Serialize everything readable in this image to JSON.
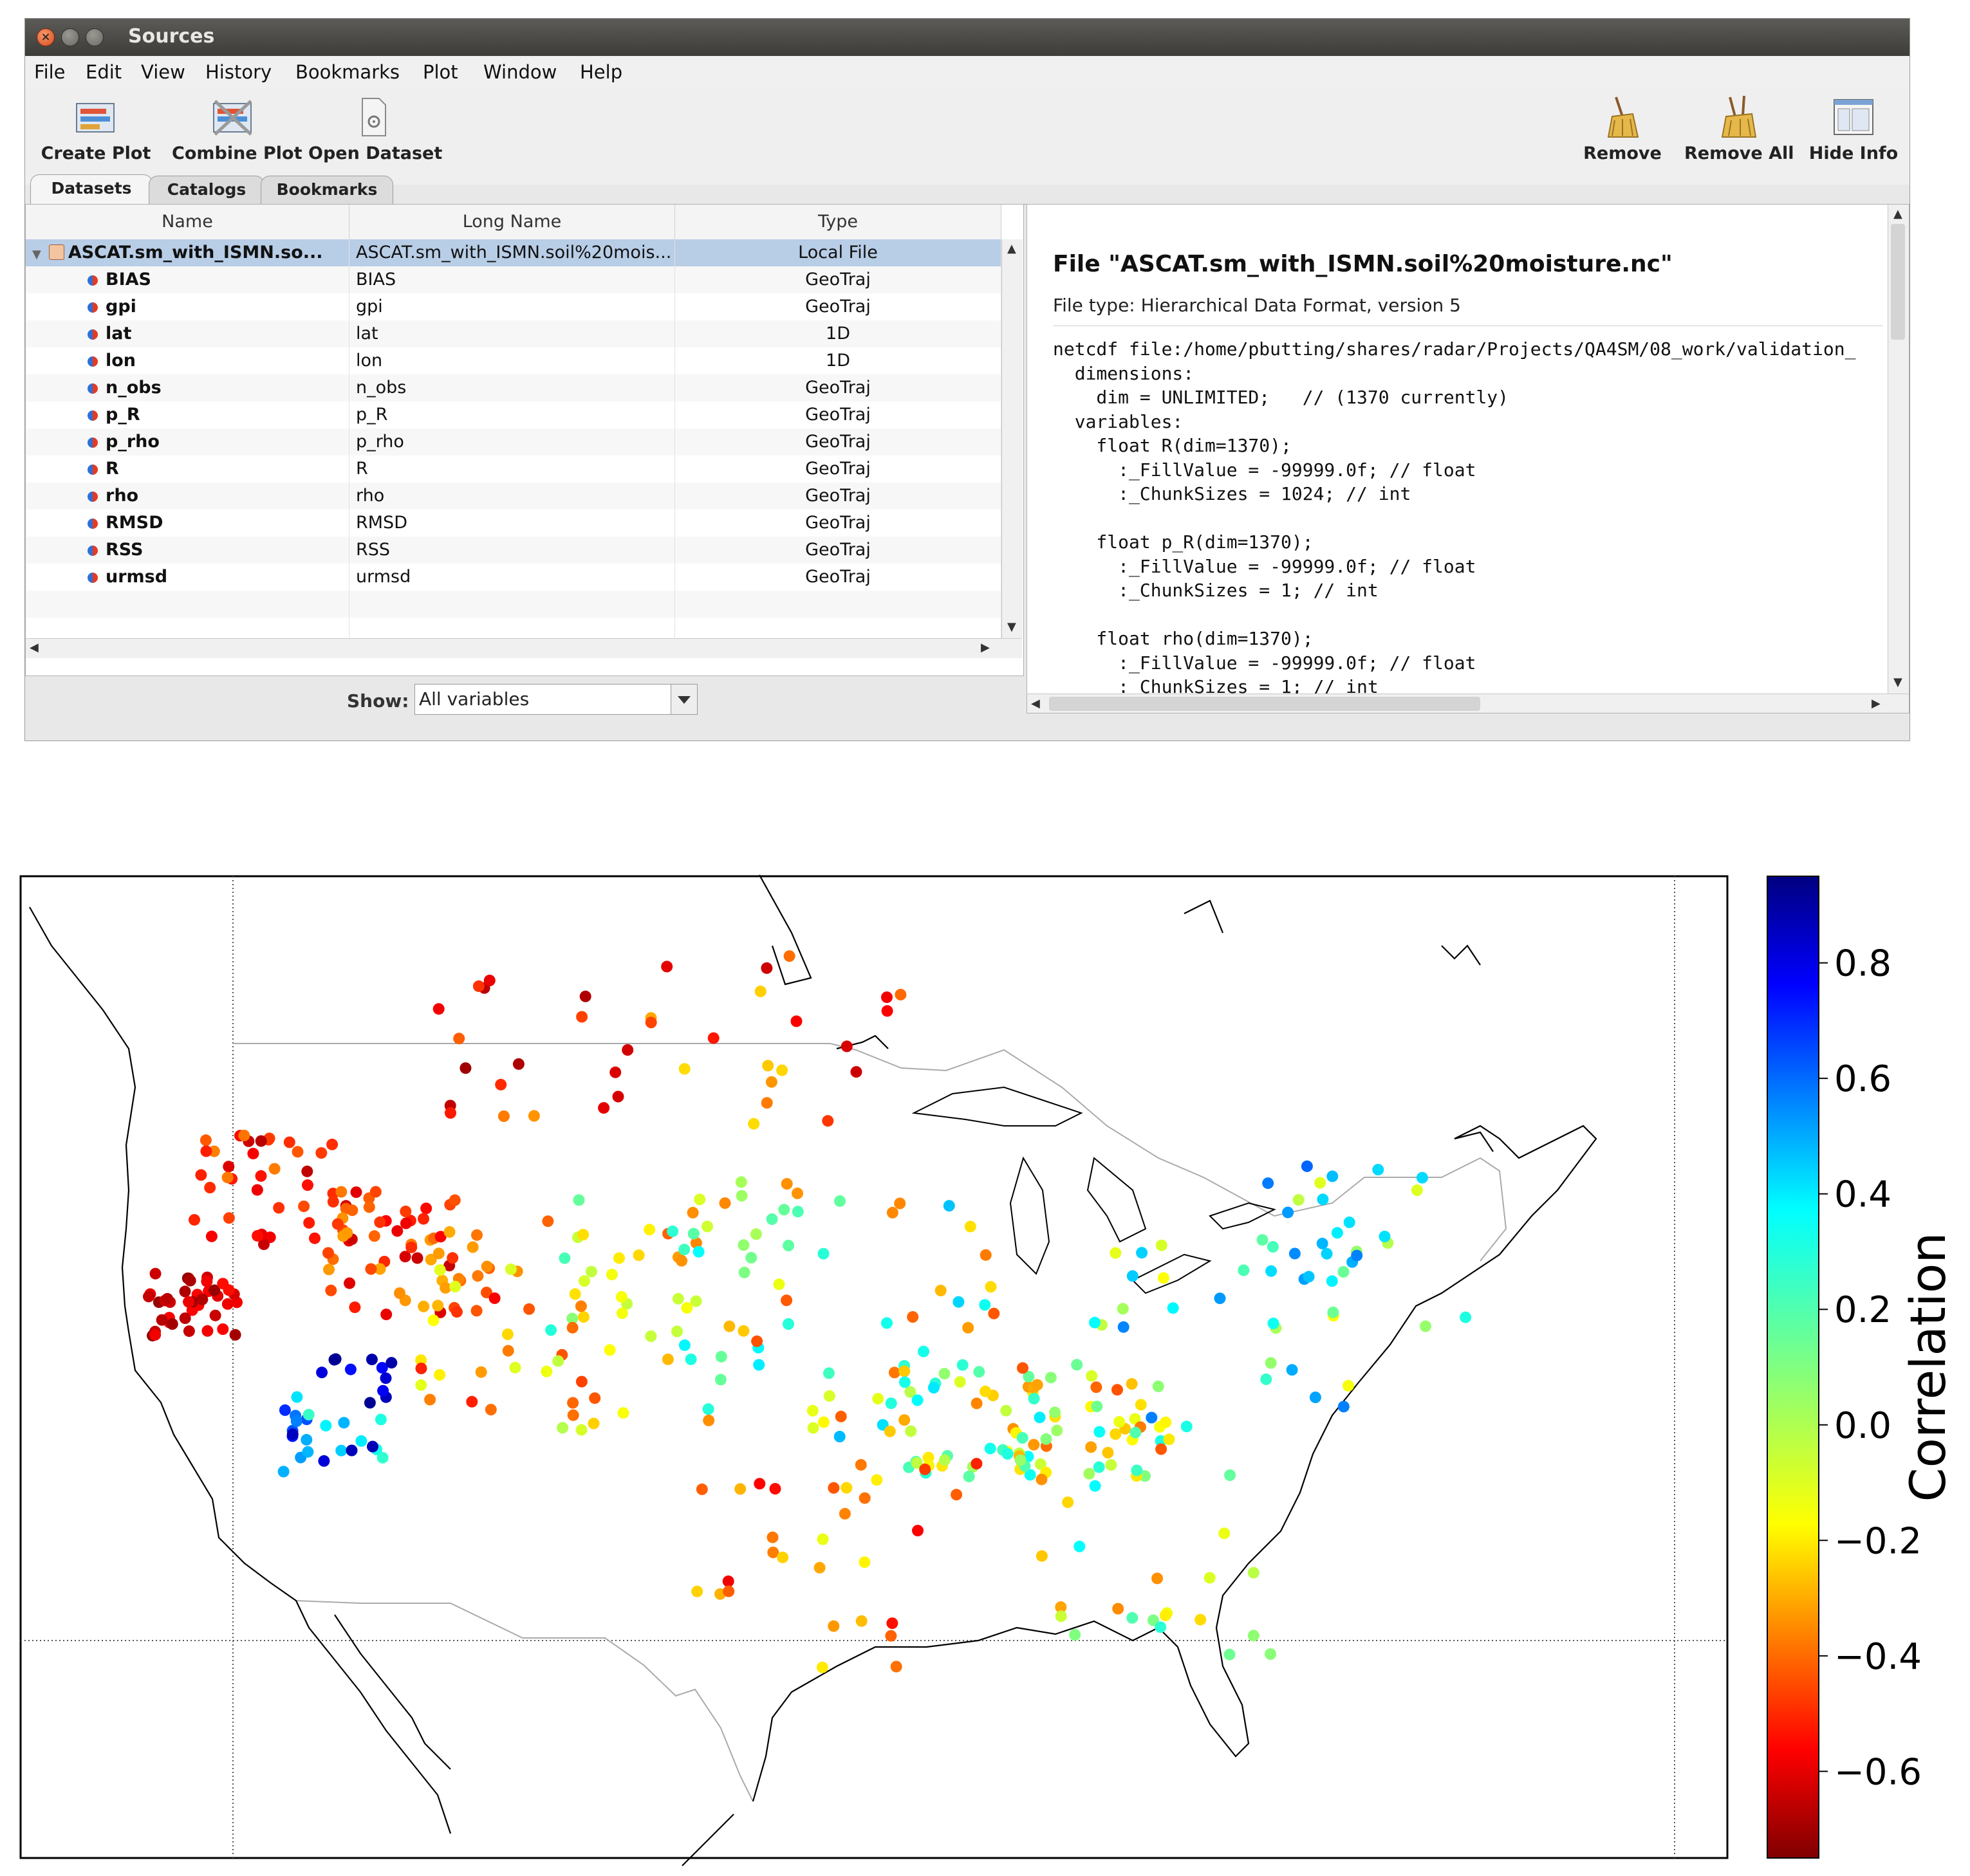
{
  "window": {
    "title": "Sources",
    "menu": [
      "File",
      "Edit",
      "View",
      "History",
      "Bookmarks",
      "Plot",
      "Window",
      "Help"
    ],
    "toolbar_left": [
      "Create Plot",
      "Combine Plot",
      "Open Dataset"
    ],
    "toolbar_right": [
      "Remove",
      "Remove All",
      "Hide Info"
    ],
    "tabs": [
      "Datasets",
      "Catalogs",
      "Bookmarks"
    ],
    "active_tab": "Datasets"
  },
  "table": {
    "headers": [
      "Name",
      "Long Name",
      "Type"
    ],
    "rows": [
      {
        "name": "ASCAT.sm_with_ISMN.so...",
        "long_name": "ASCAT.sm_with_ISMN.soil%20mois...",
        "type": "Local File",
        "selected": true,
        "kind": "file"
      },
      {
        "name": "BIAS",
        "long_name": "BIAS",
        "type": "GeoTraj"
      },
      {
        "name": "gpi",
        "long_name": "gpi",
        "type": "GeoTraj"
      },
      {
        "name": "lat",
        "long_name": "lat",
        "type": "1D"
      },
      {
        "name": "lon",
        "long_name": "lon",
        "type": "1D"
      },
      {
        "name": "n_obs",
        "long_name": "n_obs",
        "type": "GeoTraj"
      },
      {
        "name": "p_R",
        "long_name": "p_R",
        "type": "GeoTraj"
      },
      {
        "name": "p_rho",
        "long_name": "p_rho",
        "type": "GeoTraj"
      },
      {
        "name": "R",
        "long_name": "R",
        "type": "GeoTraj"
      },
      {
        "name": "rho",
        "long_name": "rho",
        "type": "GeoTraj"
      },
      {
        "name": "RMSD",
        "long_name": "RMSD",
        "type": "GeoTraj"
      },
      {
        "name": "RSS",
        "long_name": "RSS",
        "type": "GeoTraj"
      },
      {
        "name": "urmsd",
        "long_name": "urmsd",
        "type": "GeoTraj"
      }
    ]
  },
  "show": {
    "label": "Show:",
    "value": "All variables"
  },
  "info": {
    "title": "File \"ASCAT.sm_with_ISMN.soil%20moisture.nc\"",
    "file_type": "File type: Hierarchical Data Format, version 5",
    "code_lines": [
      "netcdf file:/home/pbutting/shares/radar/Projects/QA4SM/08_work/validation_",
      "  dimensions:",
      "    dim = UNLIMITED;   // (1370 currently)",
      "  variables:",
      "    float R(dim=1370);",
      "      :_FillValue = -99999.0f; // float",
      "      :_ChunkSizes = 1024; // int",
      "",
      "    float p_R(dim=1370);",
      "      :_FillValue = -99999.0f; // float",
      "      :_ChunkSizes = 1; // int",
      "",
      "    float rho(dim=1370);",
      "      :_FillValue = -99999.0f; // float",
      "      :_ChunkSizes = 1; // int"
    ]
  },
  "colorbar": {
    "label": "Correlation",
    "ticks": [
      "0.8",
      "0.6",
      "0.4",
      "0.2",
      "0.0",
      "−0.2",
      "−0.4",
      "−0.6"
    ],
    "colormap": "jet"
  }
}
